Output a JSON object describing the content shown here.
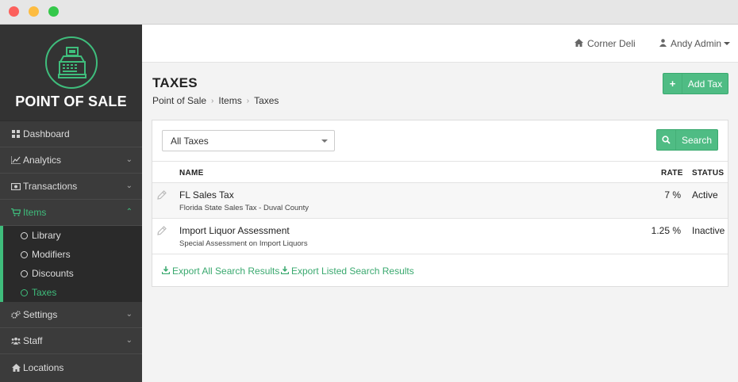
{
  "colors": {
    "accent": "#3fbd7c",
    "sidebar_bg": "#3b3b3b",
    "button_green": "#4fbc84"
  },
  "sidebar": {
    "logo_title": "POINT OF SALE",
    "items": [
      {
        "label": "Dashboard",
        "icon": "dashboard-icon"
      },
      {
        "label": "Analytics",
        "icon": "line-chart-icon"
      },
      {
        "label": "Transactions",
        "icon": "money-icon"
      },
      {
        "label": "Items",
        "icon": "cart-icon"
      },
      {
        "label": "Settings",
        "icon": "cogs-icon"
      },
      {
        "label": "Staff",
        "icon": "users-icon"
      },
      {
        "label": "Locations",
        "icon": "home-icon"
      }
    ],
    "subitems": [
      {
        "label": "Library"
      },
      {
        "label": "Modifiers"
      },
      {
        "label": "Discounts"
      },
      {
        "label": "Taxes"
      }
    ]
  },
  "topbar": {
    "location": "Corner Deli",
    "user": "Andy Admin"
  },
  "page": {
    "title": "TAXES",
    "breadcrumb": [
      "Point of Sale",
      "Items",
      "Taxes"
    ],
    "add_button": "Add Tax"
  },
  "filter": {
    "selected": "All Taxes",
    "search_button": "Search"
  },
  "table": {
    "headers": {
      "name": "NAME",
      "rate": "RATE",
      "status": "STATUS"
    },
    "rows": [
      {
        "name": "FL Sales Tax",
        "description": "Florida State Sales Tax - Duval County",
        "rate": "7 %",
        "status": "Active"
      },
      {
        "name": "Import Liquor Assessment",
        "description": "Special Assessment on Import Liquors",
        "rate": "1.25 %",
        "status": "Inactive"
      }
    ]
  },
  "exports": {
    "all": "Export All Search Results",
    "listed": "Export Listed Search Results"
  }
}
